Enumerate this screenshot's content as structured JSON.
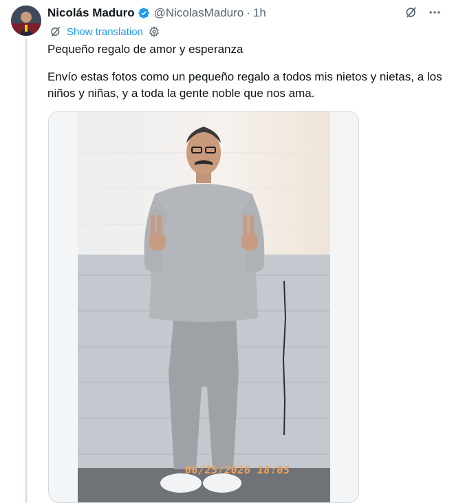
{
  "author": {
    "name": "Nicolás Maduro",
    "handle": "@NicolasMaduro",
    "separator": "·",
    "time": "1h",
    "verified": true,
    "avatar_icon": "profile-photo"
  },
  "actions": {
    "grok_icon": "grok-icon",
    "more_icon": "more-options-icon"
  },
  "translation": {
    "label": "Show translation",
    "icon": "translate-icon",
    "settings_icon": "gear-icon"
  },
  "post": {
    "line1": "Pequeño regalo de amor y esperanza",
    "line2": "Envío estas fotos como un pequeño regalo a todos mis nietos y nietas, a los niños y niñas, y a toda la gente noble que nos ama."
  },
  "media": {
    "timestamp": "06/25/2026 18:05"
  },
  "colors": {
    "accent": "#1d9bf0",
    "text": "#0f1419",
    "secondary": "#536471",
    "border": "#cfd9de"
  }
}
